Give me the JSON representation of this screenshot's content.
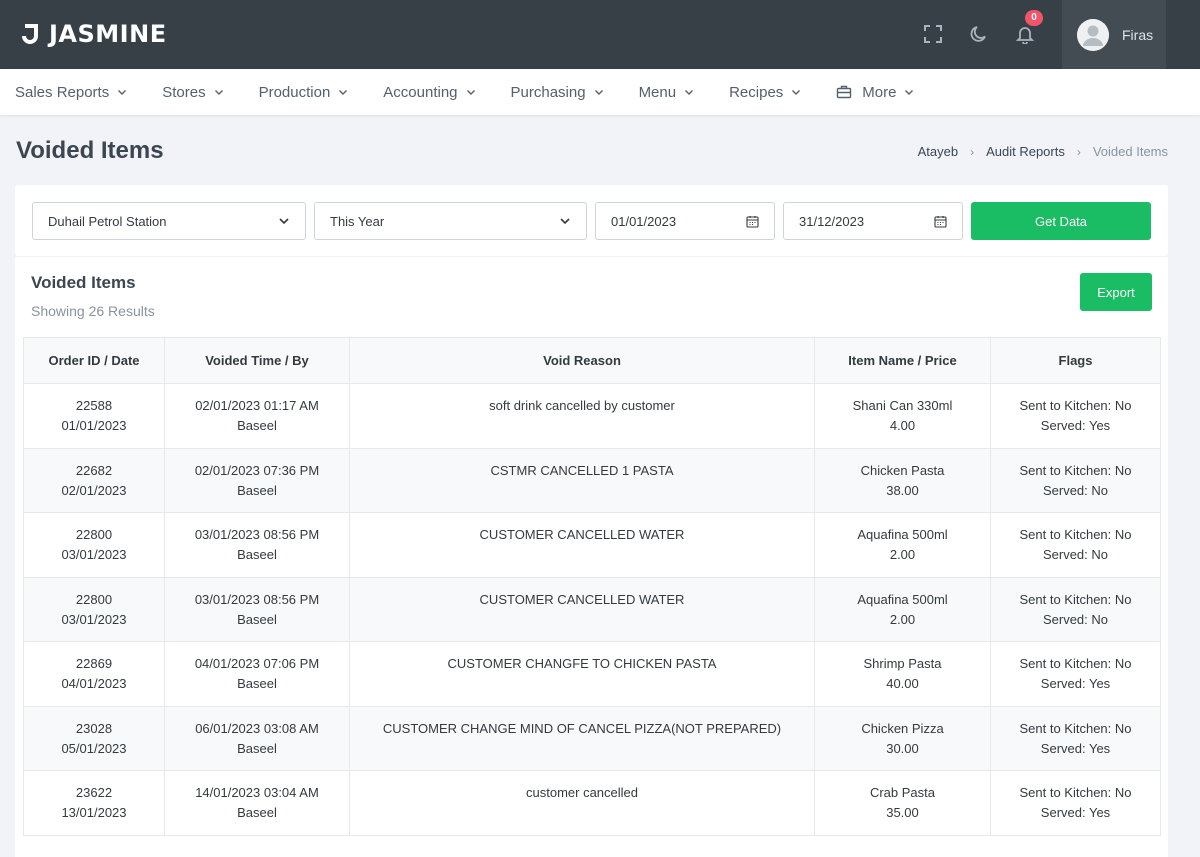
{
  "brand": {
    "name": "JASMINE"
  },
  "topbar": {
    "notification_count": "0",
    "user_name": "Firas",
    "icons": [
      "fullscreen-icon",
      "moon-icon",
      "bell-icon"
    ]
  },
  "menu": [
    {
      "label": "Sales Reports"
    },
    {
      "label": "Stores"
    },
    {
      "label": "Production"
    },
    {
      "label": "Accounting"
    },
    {
      "label": "Purchasing"
    },
    {
      "label": "Menu"
    },
    {
      "label": "Recipes"
    },
    {
      "label": "More"
    }
  ],
  "page": {
    "title": "Voided Items",
    "breadcrumb": [
      "Atayeb",
      "Audit Reports",
      "Voided Items"
    ]
  },
  "filters": {
    "store": "Duhail Petrol Station",
    "period": "This Year",
    "date_from": "01/01/2023",
    "date_to": "31/12/2023",
    "get_label": "Get Data"
  },
  "results": {
    "title": "Voided Items",
    "subtitle": "Showing 26 Results",
    "export_label": "Export",
    "columns": [
      "Order ID / Date",
      "Voided Time / By",
      "Void Reason",
      "Item Name / Price",
      "Flags"
    ],
    "rows": [
      {
        "order_id": "22588",
        "order_date": "01/01/2023",
        "voided_time": "02/01/2023 01:17 AM",
        "voided_by": "Baseel",
        "reason": "soft drink cancelled by customer",
        "item": "Shani Can 330ml",
        "price": "4.00",
        "flag_kitchen": "Sent to Kitchen: No",
        "flag_served": "Served: Yes"
      },
      {
        "order_id": "22682",
        "order_date": "02/01/2023",
        "voided_time": "02/01/2023 07:36 PM",
        "voided_by": "Baseel",
        "reason": "CSTMR CANCELLED 1 PASTA",
        "item": "Chicken Pasta",
        "price": "38.00",
        "flag_kitchen": "Sent to Kitchen: No",
        "flag_served": "Served: No"
      },
      {
        "order_id": "22800",
        "order_date": "03/01/2023",
        "voided_time": "03/01/2023 08:56 PM",
        "voided_by": "Baseel",
        "reason": "CUSTOMER CANCELLED WATER",
        "item": "Aquafina 500ml",
        "price": "2.00",
        "flag_kitchen": "Sent to Kitchen: No",
        "flag_served": "Served: No"
      },
      {
        "order_id": "22800",
        "order_date": "03/01/2023",
        "voided_time": "03/01/2023 08:56 PM",
        "voided_by": "Baseel",
        "reason": "CUSTOMER CANCELLED WATER",
        "item": "Aquafina 500ml",
        "price": "2.00",
        "flag_kitchen": "Sent to Kitchen: No",
        "flag_served": "Served: No"
      },
      {
        "order_id": "22869",
        "order_date": "04/01/2023",
        "voided_time": "04/01/2023 07:06 PM",
        "voided_by": "Baseel",
        "reason": "CUSTOMER CHANGFE TO CHICKEN PASTA",
        "item": "Shrimp Pasta",
        "price": "40.00",
        "flag_kitchen": "Sent to Kitchen: No",
        "flag_served": "Served: Yes"
      },
      {
        "order_id": "23028",
        "order_date": "05/01/2023",
        "voided_time": "06/01/2023 03:08 AM",
        "voided_by": "Baseel",
        "reason": "CUSTOMER CHANGE MIND OF CANCEL PIZZA(NOT PREPARED)",
        "item": "Chicken Pizza",
        "price": "30.00",
        "flag_kitchen": "Sent to Kitchen: No",
        "flag_served": "Served: Yes"
      },
      {
        "order_id": "23622",
        "order_date": "13/01/2023",
        "voided_time": "14/01/2023 03:04 AM",
        "voided_by": "Baseel",
        "reason": "customer cancelled",
        "item": "Crab Pasta",
        "price": "35.00",
        "flag_kitchen": "Sent to Kitchen: No",
        "flag_served": "Served: Yes"
      }
    ]
  }
}
